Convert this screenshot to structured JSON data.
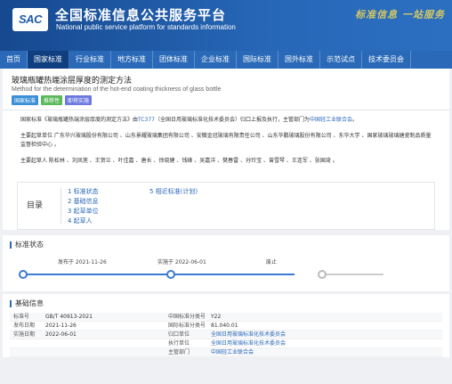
{
  "header": {
    "logo": "SAC",
    "title": "全国标准信息公共服务平台",
    "subtitle": "National public service platform  for standards information",
    "slogan": "标准信息 一站服务"
  },
  "nav": [
    "首页",
    "国家标准",
    "行业标准",
    "地方标准",
    "团体标准",
    "企业标准",
    "国际标准",
    "国外标准",
    "示范试点",
    "技术委员会"
  ],
  "standard": {
    "title": "玻璃瓶罐热端涂层厚度的测定方法",
    "title_en": "Method for the determination of the hot-end coating thickness of glass bottle",
    "tags": [
      {
        "label": "国家标准",
        "color": "#3b8fd6"
      },
      {
        "label": "推荐性",
        "color": "#5cb85c"
      },
      {
        "label": "即将实施",
        "color": "#6c7ae0"
      }
    ]
  },
  "description": {
    "p1_a": "国家标准《玻璃瓶罐热端涂层厚度的测定方法》由",
    "p1_tc": "TC377",
    "p1_b": "（全国日用玻璃标准化技术委员会）归口上报及执行，主管部门为",
    "p1_dept": "中国轻工业联合会",
    "p1_c": "。",
    "p2": "主要起草单位 广东华兴玻璃股份有限公司 、山东景耀玻璃集团有限公司 、安徽金冠玻璃有限责任公司 、山东华鹏玻璃股份有限公司 、东华大学 、国家玻璃玻璃搪瓷制品质量监督检验中心 。",
    "p3": "主要起草人 陈松林 、刘凤莲 、王贺兰 、叶佳嘉 、唐长 、徐晓健 、钱峰 、吴嘉洋 、樊春雷 、孙玲宝 、曾雪琴 、王连军 、张国琦 。"
  },
  "toc": {
    "label": "目录",
    "items": [
      "1  标准状态",
      "2  基础信息",
      "3  起草单位",
      "4  起草人"
    ],
    "items2": [
      "5  相近标准(计划)"
    ]
  },
  "status_section": {
    "title": "标准状态",
    "milestones": [
      {
        "label": "发布于 2021-11-26"
      },
      {
        "label": "实施于 2022-06-01"
      },
      {
        "label": "废止"
      }
    ]
  },
  "basic_section": {
    "title": "基础信息",
    "rows": [
      {
        "k": "标准号",
        "v": "GB/T 40913-2021",
        "k2": "中国标准分类号",
        "v2": "Y22",
        "link": false
      },
      {
        "k": "发布日期",
        "v": "2021-11-26",
        "k2": "国际标准分类号",
        "v2": "81.040.01",
        "link": false
      },
      {
        "k": "实施日期",
        "v": "2022-06-01",
        "k2": "归口单位",
        "v2": "全国日用玻璃标准化技术委员会",
        "link": true
      },
      {
        "k": "",
        "v": "",
        "k2": "执行单位",
        "v2": "全国日用玻璃标准化技术委员会",
        "link": true
      },
      {
        "k": "",
        "v": "",
        "k2": "主管部门",
        "v2": "中国轻工业联合会",
        "link": true
      }
    ]
  }
}
